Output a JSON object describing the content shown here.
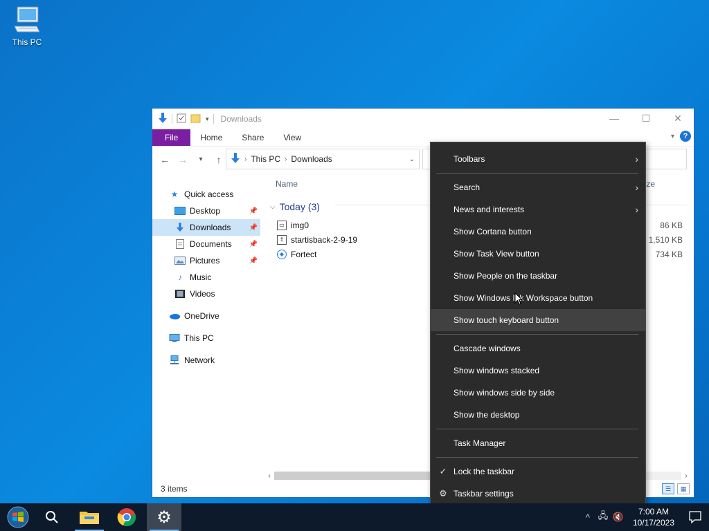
{
  "desktop": {
    "icons": [
      {
        "label": "This PC",
        "icon": "computer-icon"
      }
    ]
  },
  "explorer": {
    "title": "Downloads",
    "ribbon_tabs": [
      "File",
      "Home",
      "Share",
      "View"
    ],
    "address": {
      "segments": [
        "This PC",
        "Downloads"
      ]
    },
    "column_headers": {
      "name": "Name",
      "size_partial": "ze"
    },
    "nav_pane": [
      {
        "label": "Quick access",
        "icon": "star-icon",
        "level": 0
      },
      {
        "label": "Desktop",
        "icon": "desktop-folder-icon",
        "level": 1,
        "pinned": true
      },
      {
        "label": "Downloads",
        "icon": "download-arrow-icon",
        "level": 1,
        "pinned": true,
        "selected": true
      },
      {
        "label": "Documents",
        "icon": "documents-icon",
        "level": 1,
        "pinned": true
      },
      {
        "label": "Pictures",
        "icon": "pictures-icon",
        "level": 1,
        "pinned": true
      },
      {
        "label": "Music",
        "icon": "music-icon",
        "level": 1
      },
      {
        "label": "Videos",
        "icon": "videos-icon",
        "level": 1
      },
      {
        "label": "OneDrive",
        "icon": "cloud-icon",
        "level": 0
      },
      {
        "label": "This PC",
        "icon": "computer-icon",
        "level": 0
      },
      {
        "label": "Network",
        "icon": "network-icon",
        "level": 0
      }
    ],
    "group": {
      "label": "Today (3)"
    },
    "files": [
      {
        "name": "img0",
        "size": "86 KB",
        "icon": "image-file-icon"
      },
      {
        "name": "startisback-2-9-19",
        "size": "1,510 KB",
        "icon": "installer-icon"
      },
      {
        "name": "Fortect",
        "size": "734 KB",
        "icon": "app-icon"
      }
    ],
    "status": "3 items"
  },
  "context_menu": {
    "items": [
      {
        "label": "Toolbars",
        "submenu": true
      },
      {
        "separator": true
      },
      {
        "label": "Search",
        "submenu": true
      },
      {
        "label": "News and interests",
        "submenu": true
      },
      {
        "label": "Show Cortana button"
      },
      {
        "label": "Show Task View button"
      },
      {
        "label": "Show People on the taskbar"
      },
      {
        "label": "Show Windows Ink Workspace button"
      },
      {
        "label": "Show touch keyboard button",
        "highlighted": true
      },
      {
        "separator": true
      },
      {
        "label": "Cascade windows"
      },
      {
        "label": "Show windows stacked"
      },
      {
        "label": "Show windows side by side"
      },
      {
        "label": "Show the desktop"
      },
      {
        "separator": true
      },
      {
        "label": "Task Manager"
      },
      {
        "separator": true
      },
      {
        "label": "Lock the taskbar",
        "checked": true
      },
      {
        "label": "Taskbar settings",
        "icon": "gear-icon"
      }
    ]
  },
  "taskbar": {
    "apps": [
      {
        "name": "search-icon"
      },
      {
        "name": "file-explorer-icon",
        "running": true
      },
      {
        "name": "chrome-icon"
      },
      {
        "name": "settings-gear-icon",
        "active": true
      }
    ],
    "clock": {
      "time": "7:00 AM",
      "date": "10/17/2023"
    }
  },
  "colors": {
    "desktop": "#0a7ad4",
    "file_tab": "#7b1fa2",
    "menu_bg": "#2b2b2b",
    "taskbar": "#0d1a2b",
    "selection": "#cce4f7"
  }
}
